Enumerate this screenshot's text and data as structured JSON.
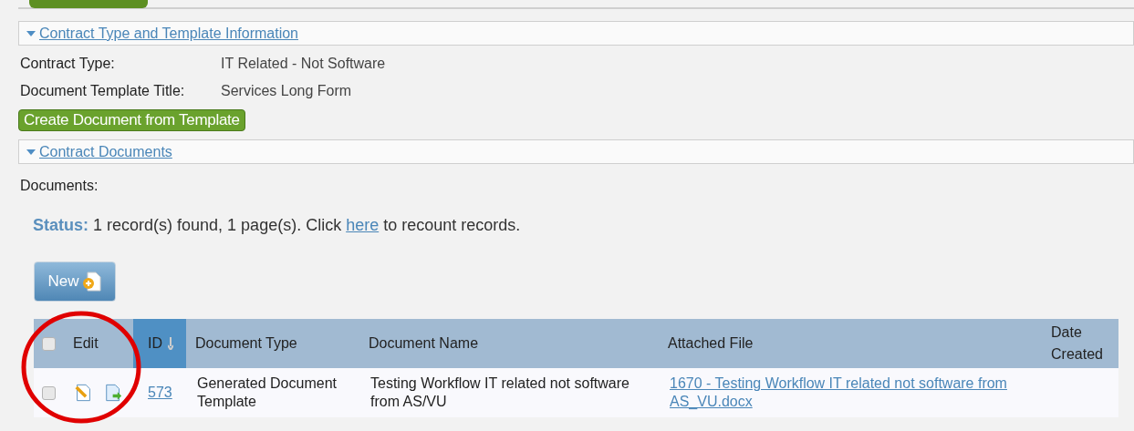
{
  "sections": [
    {
      "title": "Contract Type and Template Information",
      "expanded": true
    },
    {
      "title": "Contract Documents",
      "expanded": true
    }
  ],
  "fields": [
    {
      "label": "Contract Type:",
      "value": "IT Related - Not Software"
    },
    {
      "label": "Document Template Title:",
      "value": "Services Long Form"
    }
  ],
  "create_button": "Create Document from Template",
  "documents_label": "Documents:",
  "status": {
    "label": "Status:",
    "text_before": "1 record(s) found, 1 page(s). Click",
    "link": "here",
    "text_after": "to recount records."
  },
  "new_button": "New",
  "table": {
    "select_all": {
      "checked": false
    },
    "columns": [
      {
        "label": "Edit",
        "sorted": false
      },
      {
        "label": "ID",
        "sorted": true
      },
      {
        "label": "Document Type",
        "sorted": false
      },
      {
        "label": "Document Name",
        "sorted": false
      },
      {
        "label": "Attached File",
        "sorted": false
      },
      {
        "label": "Date Created",
        "sorted": false
      }
    ],
    "rows": [
      {
        "checked": false,
        "id": "573",
        "document_type": "Generated Document Template",
        "document_name": "Testing Workflow IT related not software from AS/VU",
        "attached_file": "1670 - Testing Workflow IT related not software from AS_VU.docx"
      }
    ]
  },
  "annotation": {
    "kind": "circle",
    "color": "#e00000"
  }
}
